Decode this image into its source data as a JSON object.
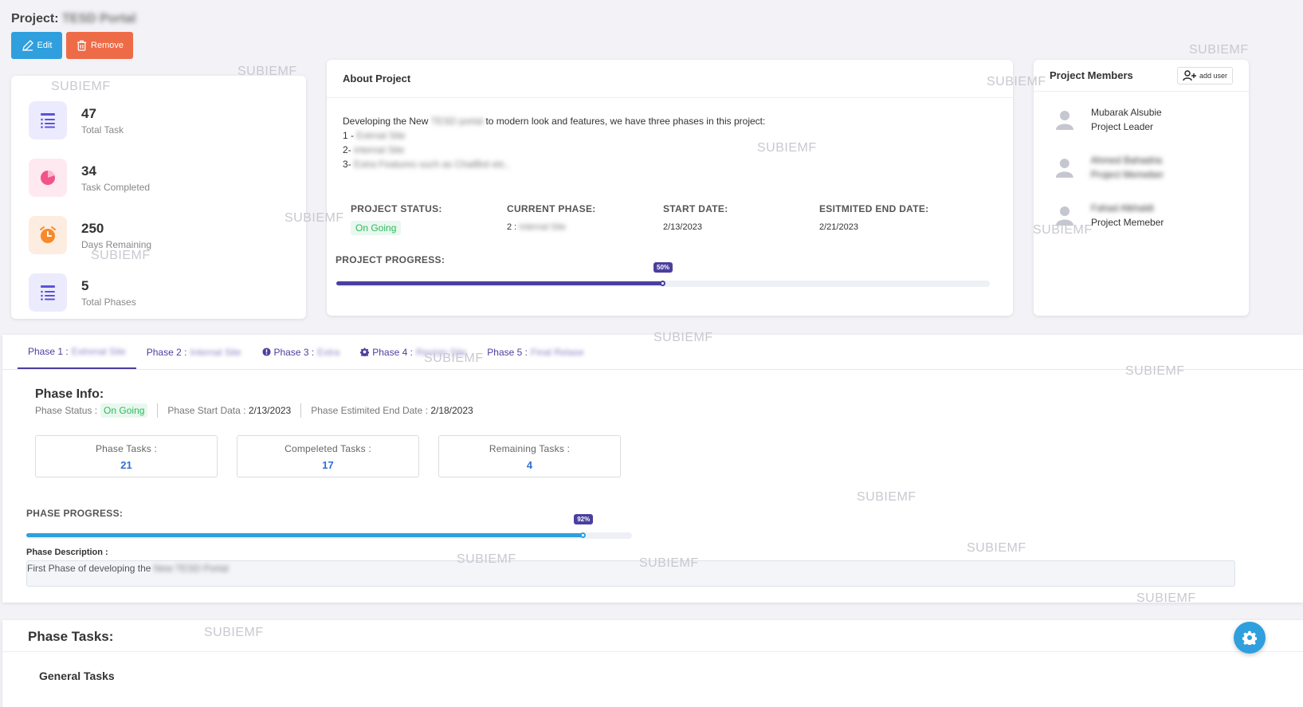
{
  "header": {
    "title_prefix": "Project:",
    "title_name": "TESD Portal",
    "edit_label": "Edit",
    "remove_label": "Remove"
  },
  "stats": [
    {
      "value": "47",
      "label": "Total Task",
      "icon": "list-icon"
    },
    {
      "value": "34",
      "label": "Task Completed",
      "icon": "pie-chart-icon"
    },
    {
      "value": "250",
      "label": "Days Remaining",
      "icon": "alarm-clock-icon"
    },
    {
      "value": "5",
      "label": "Total Phases",
      "icon": "list-icon"
    }
  ],
  "about": {
    "title": "About Project",
    "desc_prefix": "Developing the New",
    "desc_blur": "TESD portal",
    "desc_suffix": "to modern look and features, we have three phases in this project:",
    "line1_prefix": "1 -",
    "line1_blur": "Extrnal Site",
    "line2_prefix": "2-",
    "line2_blur": "internal Site",
    "line3_prefix": "3-",
    "line3_blur": "Extra Features such as ChatBot etc..",
    "status_label": "PROJECT STATUS:",
    "status_value": "On Going",
    "phase_label": "CURRENT PHASE:",
    "phase_prefix": "2 :",
    "phase_blur": "Internal Site",
    "start_label": "START DATE:",
    "start_value": "2/13/2023",
    "end_label": "ESITMITED END DATE:",
    "end_value": "2/21/2023",
    "progress_label": "PROJECT PROGRESS:",
    "progress_value": 50,
    "progress_text": "50%"
  },
  "members": {
    "title": "Project Members",
    "add_label": "add user",
    "list": [
      {
        "name": "Mubarak Alsubie",
        "role": "Project Leader",
        "blurred": false
      },
      {
        "name": "Ahmed Bahadria",
        "role": "Project Memeber",
        "blurred": true
      },
      {
        "name": "Fahad Alkhaldi",
        "role": "Project Memeber",
        "blurred": true
      }
    ]
  },
  "phase_tabs": [
    {
      "label": "Phase 1 :",
      "sub": "Extrenal Site",
      "icon": ""
    },
    {
      "label": "Phase 2 :",
      "sub": "Internal Site",
      "icon": ""
    },
    {
      "label": "Phase 3 :",
      "sub": "Extra",
      "icon": "alert-circle-icon"
    },
    {
      "label": "Phase 4 :",
      "sub": "Revisin Site",
      "icon": "gear-icon"
    },
    {
      "label": "Phase 5 :",
      "sub": "Final Relase",
      "icon": ""
    }
  ],
  "phase": {
    "title": "Phase Info:",
    "status_label": "Phase Status :",
    "status_value": "On Going",
    "start_label": "Phase Start Data :",
    "start_value": "2/13/2023",
    "end_label": "Phase Estimited End Date :",
    "end_value": "2/18/2023",
    "kpis": [
      {
        "label": "Phase Tasks :",
        "value": "21"
      },
      {
        "label": "Compeleted Tasks :",
        "value": "17"
      },
      {
        "label": "Remaining Tasks :",
        "value": "4"
      }
    ],
    "progress_label": "PHASE PROGRESS:",
    "progress_value": 92,
    "progress_text": "92%",
    "desc_label": "Phase Description :",
    "desc_prefix": "First Phase of developing the",
    "desc_blur": "New TESD Portal"
  },
  "tasks": {
    "title": "Phase Tasks:",
    "sub": "General Tasks"
  },
  "watermark": "SUBIEMF",
  "colors": {
    "primary": "#4a3f9e",
    "phase_bar": "#2f9fde",
    "edit": "#2f9fde",
    "remove": "#ee6b47",
    "success": "#2fb95d"
  }
}
